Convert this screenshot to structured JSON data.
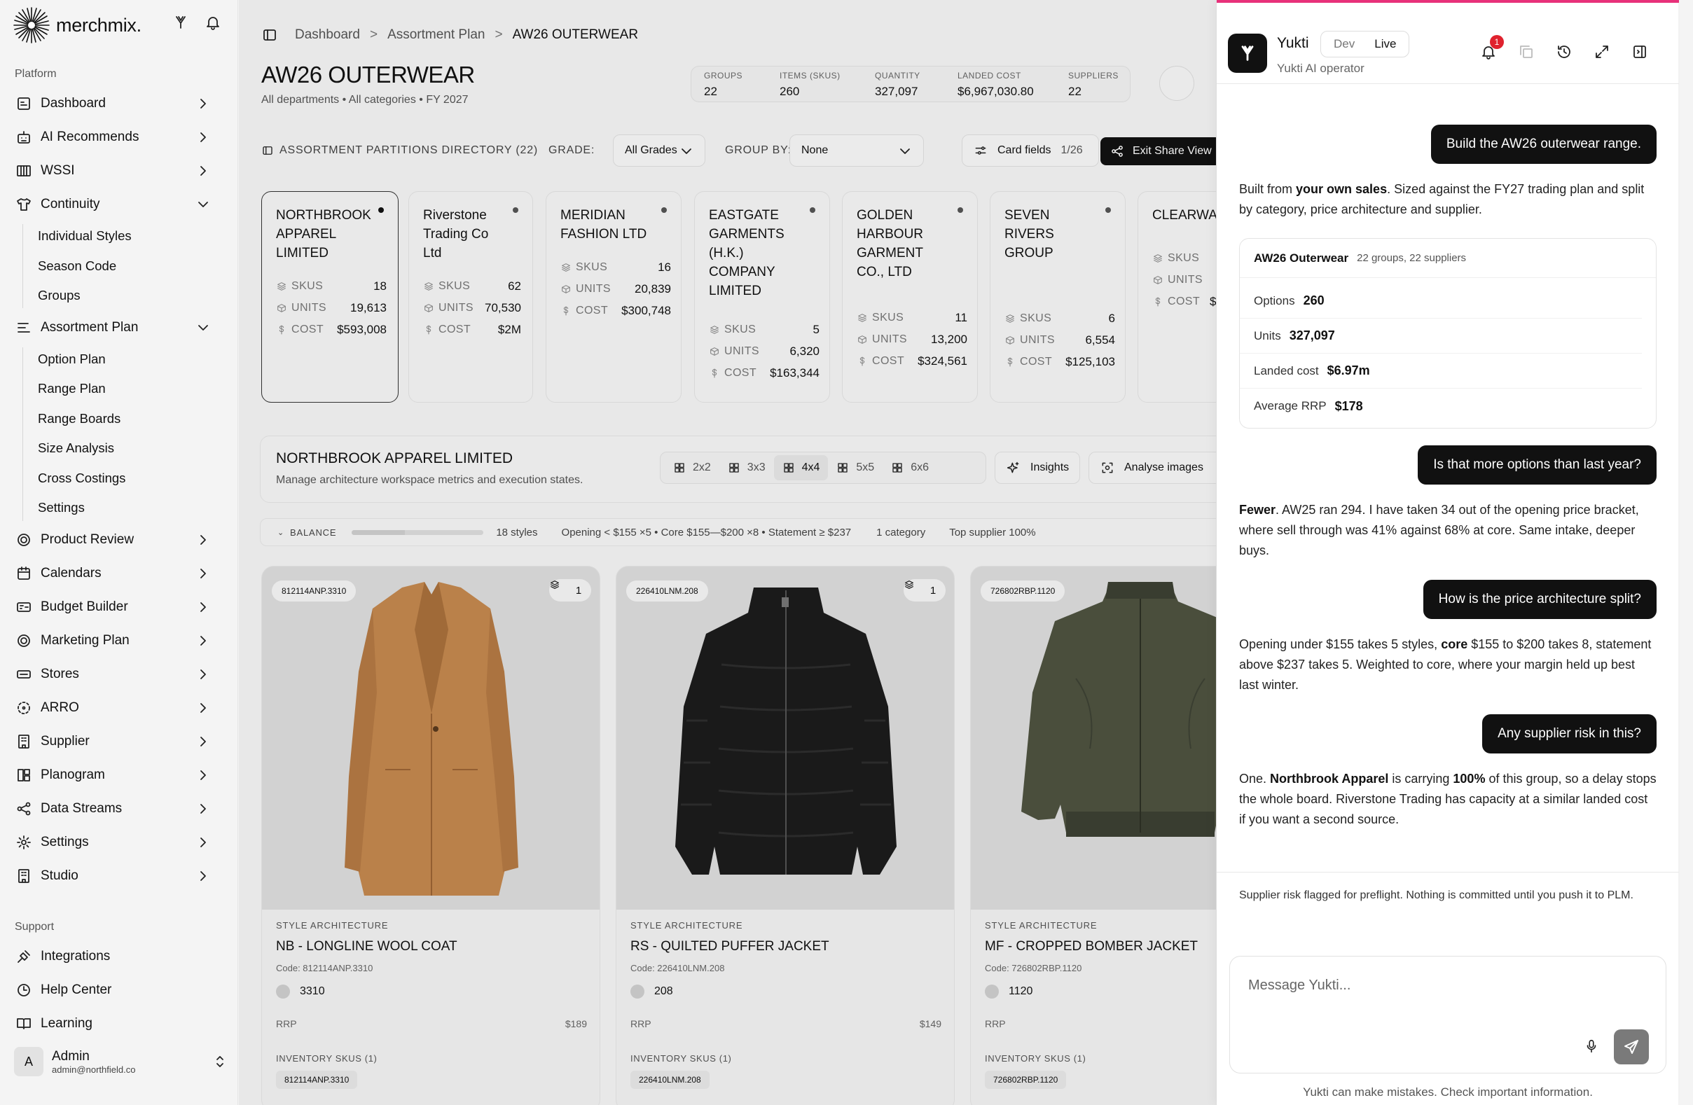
{
  "brand": {
    "name": "merchmix."
  },
  "sidebar": {
    "platform_label": "Platform",
    "items": [
      {
        "label": "Dashboard",
        "icon": "dashboard-icon"
      },
      {
        "label": "AI Recommends",
        "icon": "robot-icon"
      },
      {
        "label": "WSSI",
        "icon": "columns-icon"
      },
      {
        "label": "Continuity",
        "icon": "shirt-icon"
      },
      {
        "label": "Assortment Plan",
        "icon": "list-icon"
      },
      {
        "label": "Product Review",
        "icon": "target-icon"
      },
      {
        "label": "Calendars",
        "icon": "calendar-icon"
      },
      {
        "label": "Budget Builder",
        "icon": "calculator-icon"
      },
      {
        "label": "Marketing Plan",
        "icon": "target-icon"
      },
      {
        "label": "Stores",
        "icon": "store-icon"
      },
      {
        "label": "ARRO",
        "icon": "dashed-circle-icon"
      },
      {
        "label": "Supplier",
        "icon": "building-icon"
      },
      {
        "label": "Planogram",
        "icon": "grid-icon"
      },
      {
        "label": "Data Streams",
        "icon": "share-icon"
      },
      {
        "label": "Settings",
        "icon": "gear-icon"
      },
      {
        "label": "Studio",
        "icon": "building-icon"
      }
    ],
    "continuity_sub": [
      "Individual Styles",
      "Season Code",
      "Groups"
    ],
    "assortment_sub": [
      "Option Plan",
      "Range Plan",
      "Range Boards",
      "Size Analysis",
      "Cross Costings",
      "Settings"
    ],
    "support_label": "Support",
    "support_items": [
      {
        "label": "Integrations",
        "icon": "plug-icon"
      },
      {
        "label": "Help Center",
        "icon": "clock-icon"
      },
      {
        "label": "Learning",
        "icon": "book-icon"
      }
    ],
    "admin": {
      "initial": "A",
      "name": "Admin",
      "email": "admin@northfield.co"
    }
  },
  "breadcrumb": [
    "Dashboard",
    "Assortment Plan",
    "AW26 OUTERWEAR"
  ],
  "page": {
    "title": "AW26 OUTERWEAR",
    "subtitle": "All departments • All categories • FY 2027",
    "stats": [
      {
        "label": "GROUPS",
        "value": "22"
      },
      {
        "label": "ITEMS (SKUS)",
        "value": "260"
      },
      {
        "label": "QUANTITY",
        "value": "327,097"
      },
      {
        "label": "LANDED COST",
        "value": "$6,967,030.80"
      },
      {
        "label": "SUPPLIERS",
        "value": "22"
      }
    ]
  },
  "toolbar": {
    "directory": "ASSORTMENT PARTITIONS DIRECTORY (22)",
    "grade_label": "GRADE:",
    "grade_value": "All Grades",
    "group_label": "GROUP BY:",
    "group_value": "None",
    "fields_label": "Card fields",
    "fields_count": "1/26",
    "share_label": "Exit Share View"
  },
  "suppliers": [
    {
      "name": "NORTHBROOK APPAREL LIMITED",
      "skus": "18",
      "units": "19,613",
      "cost": "$593,008",
      "active": true
    },
    {
      "name": "Riverstone Trading Co Ltd",
      "skus": "62",
      "units": "70,530",
      "cost": "$2M"
    },
    {
      "name": "MERIDIAN FASHION LTD",
      "skus": "16",
      "units": "20,839",
      "cost": "$300,748"
    },
    {
      "name": "EASTGATE GARMENTS (H.K.) COMPANY LIMITED",
      "skus": "5",
      "units": "6,320",
      "cost": "$163,344"
    },
    {
      "name": "GOLDEN HARBOUR GARMENT CO., LTD",
      "skus": "11",
      "units": "13,200",
      "cost": "$324,561"
    },
    {
      "name": "SEVEN RIVERS GROUP",
      "skus": "6",
      "units": "6,554",
      "cost": "$125,103"
    },
    {
      "name": "CLEARWATER GARMENT FACTORY LTD",
      "skus": "",
      "units": "",
      "cost": "$"
    }
  ],
  "supplier_labels": {
    "skus": "SKUS",
    "units": "UNITS",
    "cost": "COST"
  },
  "workspace": {
    "title": "NORTHBROOK APPAREL LIMITED",
    "subtitle": "Manage architecture workspace metrics and execution states.",
    "grid_options": [
      "2x2",
      "3x3",
      "4x4",
      "5x5",
      "6x6"
    ],
    "grid_selected": "4x4",
    "insights_label": "Insights",
    "analyse_label": "Analyse images"
  },
  "balance": {
    "label": "BALANCE",
    "fill_fraction": 0.4,
    "styles": "18 styles",
    "breakdown": "Opening < $155 ×5 • Core $155—$200 ×8 • Statement ≥ $237",
    "categories": "1 category",
    "top_supplier": "Top supplier 100%"
  },
  "products": [
    {
      "tag": "812114ANP.3310",
      "count": "1",
      "arch_label": "STYLE ARCHITECTURE",
      "name": "NB - LONGLINE WOOL COAT",
      "code": "Code: 812114ANP.3310",
      "color": "3310",
      "rrp_label": "RRP",
      "rrp": "$189",
      "inv_label": "INVENTORY SKUS (1)",
      "inv_tag": "812114ANP.3310",
      "garment": "coat",
      "garment_color": "#c48a52"
    },
    {
      "tag": "226410LNM.208",
      "count": "1",
      "arch_label": "STYLE ARCHITECTURE",
      "name": "RS - QUILTED PUFFER JACKET",
      "code": "Code: 226410LNM.208",
      "color": "208",
      "rrp_label": "RRP",
      "rrp": "$149",
      "inv_label": "INVENTORY SKUS (1)",
      "inv_tag": "226410LNM.208",
      "garment": "puffer",
      "garment_color": "#1d1d1d"
    },
    {
      "tag": "726802RBP.1120",
      "count": "",
      "arch_label": "STYLE ARCHITECTURE",
      "name": "MF - CROPPED BOMBER JACKET",
      "code": "Code: 726802RBP.1120",
      "color": "1120",
      "rrp_label": "RRP",
      "rrp": "",
      "inv_label": "INVENTORY SKUS (1)",
      "inv_tag": "726802RBP.1120",
      "garment": "bomber",
      "garment_color": "#4e5340"
    }
  ],
  "chat": {
    "name": "Yukti",
    "env": [
      "Dev",
      "Live"
    ],
    "env_selected": "Live",
    "subtitle": "Yukti AI operator",
    "notif_count": "1",
    "msg1": "Build the AW26 outerwear range.",
    "reply1_pre": "Built from ",
    "reply1_bold": "your own sales",
    "reply1_post": ". Sized against the FY27 trading plan and split by category, price architecture and supplier.",
    "card": {
      "title": "AW26 Outerwear",
      "sub": "22 groups, 22 suppliers",
      "rows": [
        {
          "label": "Options",
          "value": "260"
        },
        {
          "label": "Units",
          "value": "327,097"
        },
        {
          "label": "Landed cost",
          "value": "$6.97m"
        },
        {
          "label": "Average RRP",
          "value": "$178"
        }
      ]
    },
    "msg2": "Is that more options than last year?",
    "reply2_bold": "Fewer",
    "reply2_post": ". AW25 ran 294. I have taken 34 out of the opening price bracket, where sell through was 41% against 68% at core. Same intake, deeper buys.",
    "msg3": "How is the price architecture split?",
    "reply3_pre": "Opening under $155 takes 5 styles, ",
    "reply3_bold": "core",
    "reply3_post": " $155 to $200 takes 8, statement above $237 takes 5. Weighted to core, where your margin held up best last winter.",
    "msg4": "Any supplier risk in this?",
    "reply4_pre": "One. ",
    "reply4_bold1": "Northbrook Apparel",
    "reply4_mid": " is carrying ",
    "reply4_bold2": "100%",
    "reply4_post": " of this group, so a delay stops the whole board. Riverstone Trading has capacity at a similar landed cost if you want a second source.",
    "note": "Supplier risk flagged for preflight. Nothing is committed until you push it to PLM.",
    "placeholder": "Message Yukti...",
    "disclaimer": "Yukti can make mistakes. Check important information."
  }
}
